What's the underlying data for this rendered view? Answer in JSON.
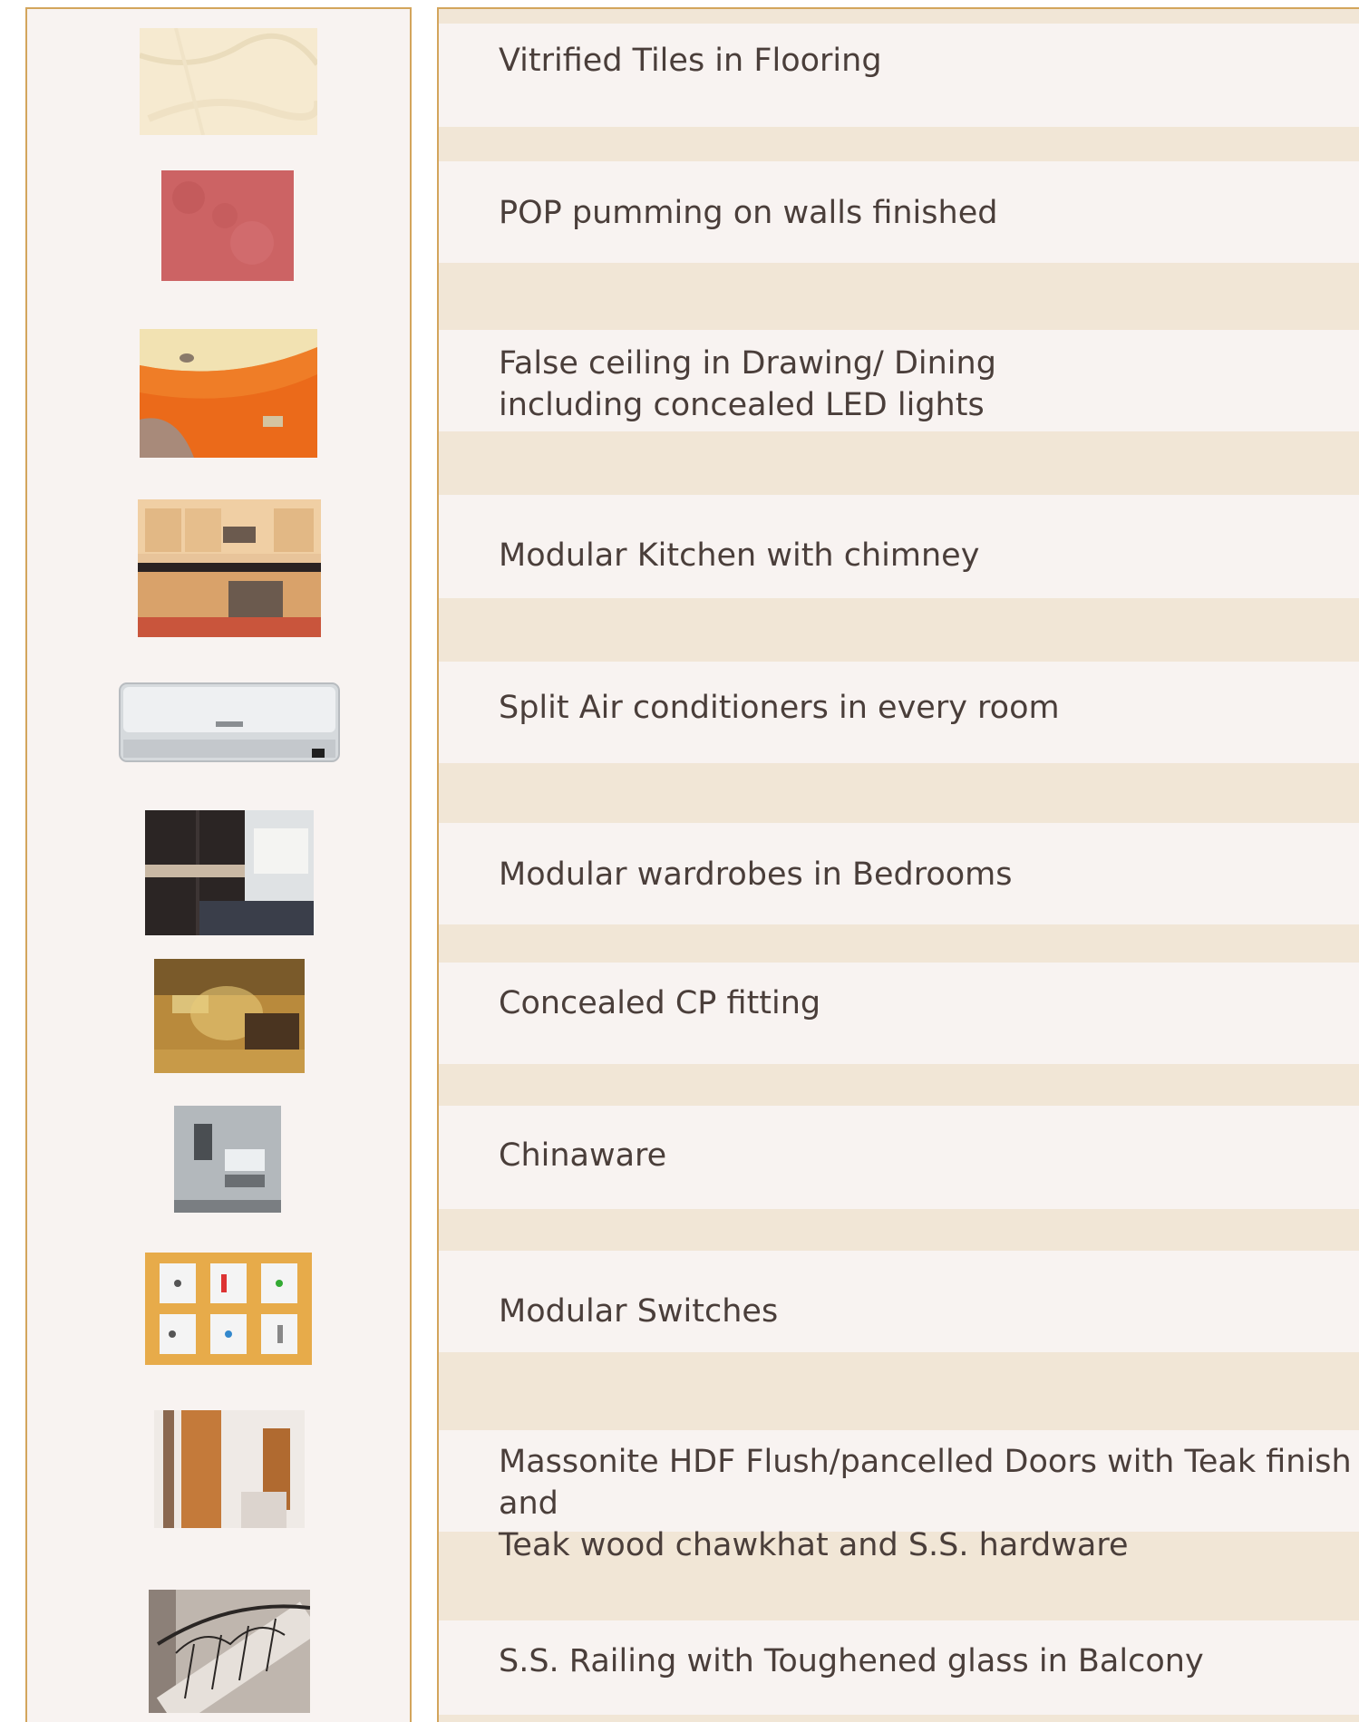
{
  "features": [
    {
      "text": "Vitrified Tiles in Flooring",
      "image_icon": "vitrified-tiles-swatch"
    },
    {
      "text": "POP pumming on walls finished",
      "image_icon": "textured-wall-swatch"
    },
    {
      "text": "False ceiling in Drawing/ Dining\nincluding concealed LED lights",
      "image_icon": "false-ceiling-photo"
    },
    {
      "text": "Modular Kitchen with chimney",
      "image_icon": "modular-kitchen-photo"
    },
    {
      "text": "Split Air conditioners in every room",
      "image_icon": "split-ac-photo"
    },
    {
      "text": "Modular wardrobes in Bedrooms",
      "image_icon": "wardrobe-bedroom-photo"
    },
    {
      "text": "Concealed CP fitting",
      "image_icon": "bathroom-fitting-photo"
    },
    {
      "text": "Chinaware",
      "image_icon": "chinaware-photo"
    },
    {
      "text": "Modular Switches",
      "image_icon": "modular-switches-photo"
    },
    {
      "text": "Massonite HDF Flush/pancelled Doors with Teak finish and\nTeak wood chawkhat and S.S. hardware",
      "image_icon": "teak-door-photo"
    },
    {
      "text": "S.S. Railing with Toughened glass in Balcony",
      "image_icon": "ss-railing-photo"
    }
  ],
  "colors": {
    "panel_border": "#d3a55c",
    "panel_background": "#f8f3f1",
    "band": "#f1e6d6",
    "text": "#4a3e3a"
  }
}
